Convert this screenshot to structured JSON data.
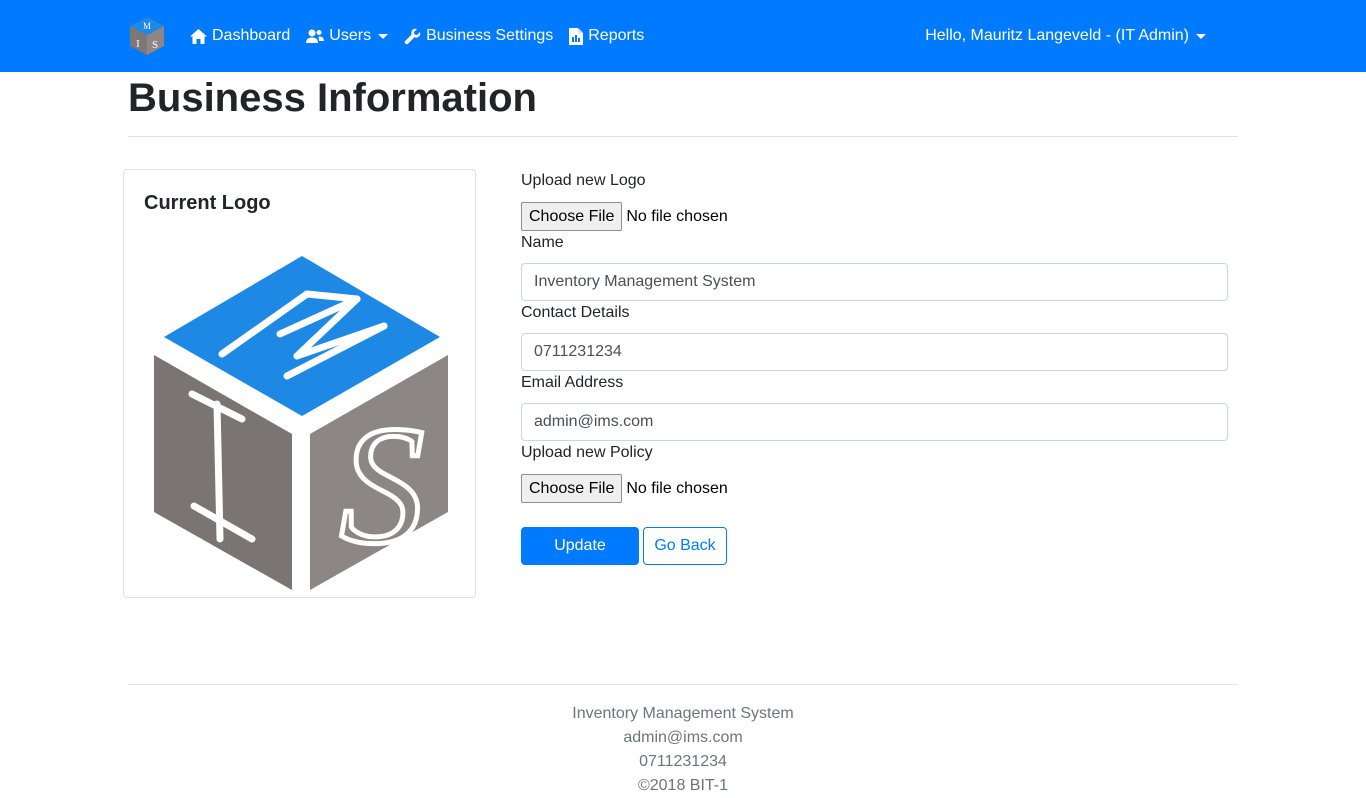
{
  "nav": {
    "brand_logo": "ims-cube-logo",
    "items": [
      {
        "label": "Dashboard",
        "icon": "home-icon"
      },
      {
        "label": "Users",
        "icon": "users-icon",
        "dropdown": true
      },
      {
        "label": "Business Settings",
        "icon": "wrench-icon"
      },
      {
        "label": "Reports",
        "icon": "report-icon"
      }
    ],
    "user_menu": "Hello, Mauritz Langeveld - (IT Admin)"
  },
  "page": {
    "title": "Business Information"
  },
  "logo_card": {
    "title": "Current Logo"
  },
  "form": {
    "logo_label": "Upload new Logo",
    "logo_button": "Choose File",
    "logo_status": "No file chosen",
    "name_label": "Name",
    "name_value": "Inventory Management System",
    "contact_label": "Contact Details",
    "contact_value": "0711231234",
    "email_label": "Email Address",
    "email_value": "admin@ims.com",
    "policy_label": "Upload new Policy",
    "policy_button": "Choose File",
    "policy_status": "No file chosen",
    "update_button": "Update",
    "back_button": "Go Back"
  },
  "footer": {
    "line1": "Inventory Management System",
    "line2": "admin@ims.com",
    "line3": "0711231234",
    "line4": "©2018 BIT-1"
  },
  "colors": {
    "primary": "#007bff",
    "cube_top": "#1e88e5",
    "cube_side": "#7d7775"
  }
}
